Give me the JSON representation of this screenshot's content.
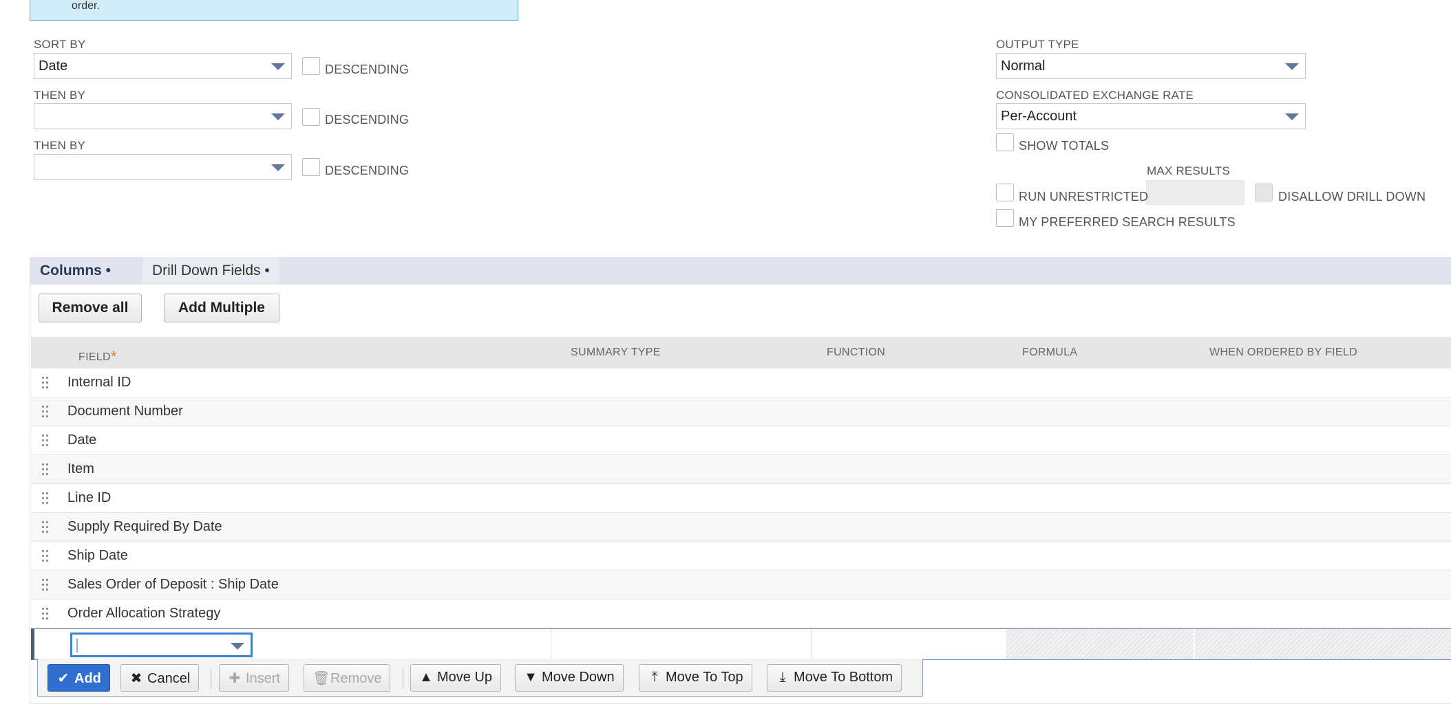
{
  "banner": {
    "text": "order."
  },
  "sort": {
    "sort_by_label": "SORT BY",
    "sort_by_value": "Date",
    "then_by_label": "THEN BY",
    "then_by_1_value": "",
    "then_by_2_value": "",
    "descending_label": "DESCENDING"
  },
  "output": {
    "output_type_label": "OUTPUT TYPE",
    "output_type_value": "Normal",
    "exchange_rate_label": "CONSOLIDATED EXCHANGE RATE",
    "exchange_rate_value": "Per-Account",
    "show_totals_label": "SHOW TOTALS",
    "max_results_label": "MAX RESULTS",
    "run_unrestricted_label": "RUN UNRESTRICTED",
    "disallow_drill_down_label": "DISALLOW DRILL DOWN",
    "my_preferred_label": "MY PREFERRED SEARCH RESULTS"
  },
  "tabs": [
    {
      "label": "Columns •"
    },
    {
      "label": "Drill Down Fields •"
    }
  ],
  "actions": {
    "remove_all": "Remove all",
    "add_multiple": "Add Multiple"
  },
  "table": {
    "headers": {
      "field": "FIELD",
      "required_mark": "*",
      "summary_type": "SUMMARY TYPE",
      "function": "FUNCTION",
      "formula": "FORMULA",
      "when_ordered": "WHEN ORDERED BY FIELD"
    },
    "rows": [
      "Internal ID",
      "Document Number",
      "Date",
      "Item",
      "Line ID",
      "Supply Required By Date",
      "Ship Date",
      "Sales Order of Deposit : Ship Date",
      "Order Allocation Strategy"
    ]
  },
  "toolbar": {
    "add": "Add",
    "cancel": "Cancel",
    "insert": "Insert",
    "remove": "Remove",
    "move_up": "Move Up",
    "move_down": "Move Down",
    "move_to_top": "Move To Top",
    "move_to_bottom": "Move To Bottom"
  },
  "colors": {
    "accent": "#2e6fd0",
    "tab_bar": "#dfe4ee",
    "banner_bg": "#d2edfa",
    "caret": "#607799"
  }
}
